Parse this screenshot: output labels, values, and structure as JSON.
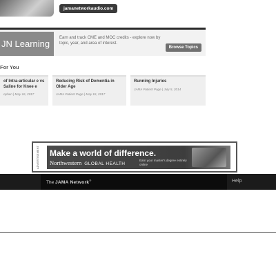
{
  "top": {
    "audio_link": "jamanetworkaudio.com"
  },
  "jn_learning": {
    "title": "JN Learning",
    "description": "Earn and track CME and MOC credits - explore now by topic, year, and area of interest.",
    "browse_label": "Browse Topics"
  },
  "for_you": {
    "heading": "For You",
    "cards": [
      {
        "title": "of Intra-articular e vs Saline for Knee e",
        "meta": "ophen | May 16, 2017"
      },
      {
        "title": "Reducing Risk of Dementia in Older Age",
        "meta": "JAMA Patient Page | May 16, 2017"
      },
      {
        "title": "Running Injuries",
        "meta": "JAMA Patient Page | July 5, 2014"
      }
    ]
  },
  "ad": {
    "side_label": "ADVERTISEMENT",
    "headline": "Make a world of difference.",
    "brand": "Northwestern",
    "brand_sub": "GLOBAL HEALTH",
    "tagline": "Earn your master's degree entirely online"
  },
  "footer": {
    "logo_prefix": "The",
    "logo_name": "JAMA Network",
    "logo_mark": "®",
    "help": "Help"
  }
}
